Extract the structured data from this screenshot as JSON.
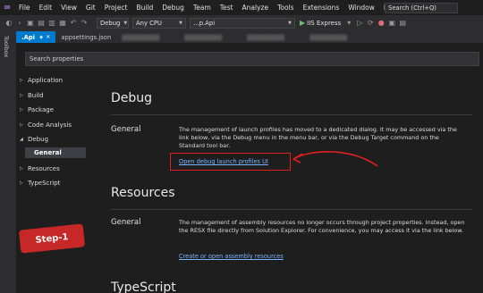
{
  "menubar": {
    "items": [
      "File",
      "Edit",
      "View",
      "Git",
      "Project",
      "Build",
      "Debug",
      "Team",
      "Test",
      "Analyze",
      "Tools",
      "Extensions",
      "Window",
      "Help"
    ],
    "search": "Search (Ctrl+Q)"
  },
  "toolbar": {
    "config": "Debug",
    "platform": "Any CPU",
    "project": "…p.Api",
    "run_label": "IIS Express"
  },
  "toolbox": {
    "label": "Toolbox"
  },
  "tabs": [
    {
      "label": ".Api"
    },
    {
      "label": "appsettings.json"
    }
  ],
  "props": {
    "search_placeholder": "Search properties",
    "nav": [
      {
        "label": "Application",
        "expanded": false
      },
      {
        "label": "Build",
        "expanded": false
      },
      {
        "label": "Package",
        "expanded": false
      },
      {
        "label": "Code Analysis",
        "expanded": false
      },
      {
        "label": "Debug",
        "expanded": true
      },
      {
        "label": "Resources",
        "expanded": false
      },
      {
        "label": "TypeScript",
        "expanded": false
      }
    ],
    "nav_sub_selected": "General",
    "debug": {
      "title": "Debug",
      "general_label": "General",
      "text": "The management of launch profiles has moved to a dedicated dialog. It may be accessed via the link below, via the Debug menu in the menu bar, or via the Debug Target command on the Standard tool bar.",
      "link": "Open debug launch profiles UI"
    },
    "resources": {
      "title": "Resources",
      "general_label": "General",
      "text": "The management of assembly resources no longer occurs through project properties. Instead, open the RESX file directly from Solution Explorer. For convenience, you may access it via the link below.",
      "link": "Create or open assembly resources"
    },
    "typescript": {
      "title": "TypeScript"
    }
  },
  "annotation": {
    "step_label": "Step-1",
    "color": "#c62828"
  }
}
